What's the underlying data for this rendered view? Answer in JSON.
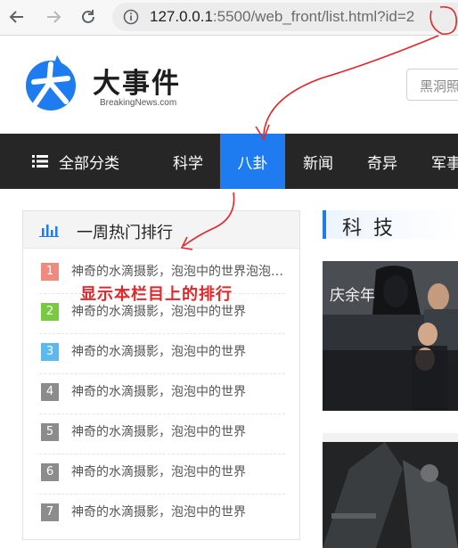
{
  "browser": {
    "url_host": "127.0.0.1",
    "url_rest": ":5500/web_front/list.html?id=2"
  },
  "header": {
    "logo_title": "大事件",
    "logo_subtitle": "BreakingNews.com",
    "search_placeholder": "黑洞照"
  },
  "nav": {
    "all_label": "全部分类",
    "items": [
      {
        "label": "科学",
        "active": false
      },
      {
        "label": "八卦",
        "active": true
      },
      {
        "label": "新闻",
        "active": false
      },
      {
        "label": "奇异",
        "active": false
      },
      {
        "label": "军事",
        "active": false
      }
    ]
  },
  "rank": {
    "title": "一周热门排行",
    "items": [
      {
        "num": "1",
        "text": "神奇的水滴摄影，泡泡中的世界泡泡中的世界",
        "color": "#f08a7e"
      },
      {
        "num": "2",
        "text": "神奇的水滴摄影，泡泡中的世界",
        "color": "#7ac943"
      },
      {
        "num": "3",
        "text": "神奇的水滴摄影，泡泡中的世界",
        "color": "#5bb9f0"
      },
      {
        "num": "4",
        "text": "神奇的水滴摄影，泡泡中的世界",
        "color": "#8c8c8c"
      },
      {
        "num": "5",
        "text": "神奇的水滴摄影，泡泡中的世界",
        "color": "#8c8c8c"
      },
      {
        "num": "6",
        "text": "神奇的水滴摄影，泡泡中的世界",
        "color": "#8c8c8c"
      },
      {
        "num": "7",
        "text": "神奇的水滴摄影，泡泡中的世界",
        "color": "#8c8c8c"
      }
    ]
  },
  "section": {
    "title": "科 技",
    "poster_text": "庆余年"
  },
  "annotation": {
    "note": "显示本栏目上的排行"
  },
  "colors": {
    "nav_bg": "#262626",
    "active": "#1e7cf0",
    "annotation": "#e3262a"
  }
}
